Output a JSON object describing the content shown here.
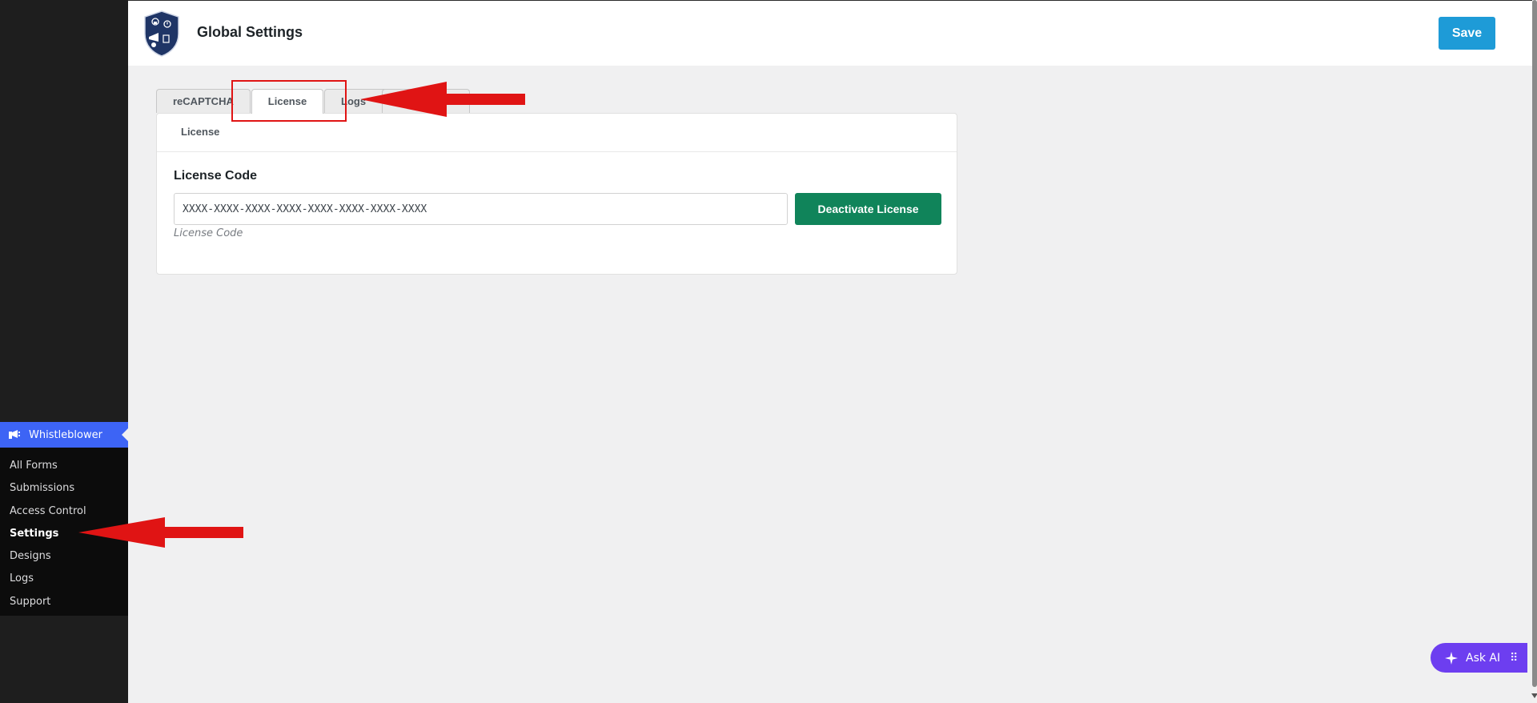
{
  "sidebar": {
    "menu_title": "Whistleblower",
    "items": [
      {
        "label": "All Forms"
      },
      {
        "label": "Submissions"
      },
      {
        "label": "Access Control"
      },
      {
        "label": "Settings",
        "active": true
      },
      {
        "label": "Designs"
      },
      {
        "label": "Logs"
      },
      {
        "label": "Support"
      }
    ]
  },
  "header": {
    "title": "Global Settings",
    "save_label": "Save"
  },
  "tabs": [
    {
      "label": "reCAPTCHA"
    },
    {
      "label": "License",
      "active": true
    },
    {
      "label": "Logs"
    },
    {
      "label": ""
    }
  ],
  "license_panel": {
    "heading": "License",
    "field_label": "License Code",
    "input_value": "XXXX-XXXX-XXXX-XXXX-XXXX-XXXX-XXXX-XXXX",
    "hint": "License Code",
    "deactivate_label": "Deactivate License"
  },
  "ask_ai": {
    "label": "Ask AI"
  },
  "colors": {
    "sidebar_bg": "#1e1e1e",
    "menu_accent": "#3d64f5",
    "save_button": "#1e9bd7",
    "deactivate_button": "#10845a",
    "ask_ai": "#6d3ef0",
    "annotation": "#e01414"
  }
}
